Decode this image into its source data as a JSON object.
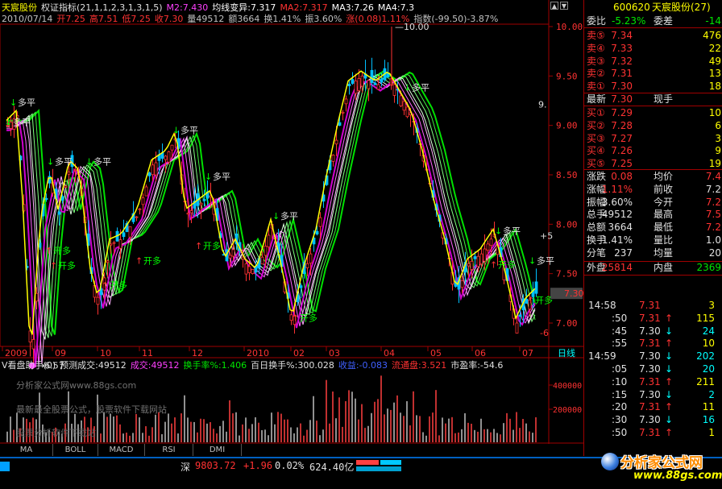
{
  "header": {
    "line1": [
      {
        "text": "天宸股份",
        "color": "#ffff00"
      },
      {
        "text": "权证指标(21,1,1,2,3,1,3,1,5)",
        "color": "#e0e0e0"
      },
      {
        "text": "M2:7.430",
        "color": "#ff40ff"
      },
      {
        "text": "均线变异:7.317",
        "color": "#ffffff"
      },
      {
        "text": "MA2:7.317",
        "color": "#ff3232"
      },
      {
        "text": "MA3:7.26",
        "color": "#ffffff"
      },
      {
        "text": "MA4:7.3",
        "color": "#ffffff"
      }
    ],
    "line2": [
      {
        "text": "2010/07/14",
        "color": "#c0c0c0"
      },
      {
        "text": "开7.25",
        "color": "#ff3232"
      },
      {
        "text": "高7.51",
        "color": "#ff3232"
      },
      {
        "text": "低7.25",
        "color": "#ff3232"
      },
      {
        "text": "收7.30",
        "color": "#ff3232"
      },
      {
        "text": "量49512",
        "color": "#c0c0c0"
      },
      {
        "text": "额3664",
        "color": "#c0c0c0"
      },
      {
        "text": "换1.41%",
        "color": "#c0c0c0"
      },
      {
        "text": "振3.60%",
        "color": "#c0c0c0"
      },
      {
        "text": "涨(0.08)1.11%",
        "color": "#ff3232"
      },
      {
        "text": "指数(-99.50)-3.87%",
        "color": "#c0c0c0"
      }
    ]
  },
  "price_axis": [
    "10.00",
    "9.50",
    "9.00",
    "8.50",
    "8.00",
    "7.50",
    "7.00"
  ],
  "price_marks": {
    "high": "10.00",
    "low": "6.57",
    "current": "7.30",
    "side_high": "9.",
    "side_low": "-6",
    "side_mid": "+5"
  },
  "signals": {
    "sell": "多平",
    "buy": "开多",
    "mixed": "开多平",
    "reverse": "多平"
  },
  "date_axis": [
    "2009",
    "09",
    "10",
    "11",
    "12",
    "2010",
    "02",
    "03",
    "04",
    "05",
    "06",
    "07"
  ],
  "period_label": "日线",
  "volume_header": [
    {
      "text": "V看盘助手(0)",
      "color": "#e0e0e0"
    },
    {
      "text": "预测成交:49512",
      "color": "#e0e0e0"
    },
    {
      "text": "成交:49512",
      "color": "#ff40ff"
    },
    {
      "text": "换手率%:1.406",
      "color": "#00e600"
    },
    {
      "text": "百日换手%:300.028",
      "color": "#e0e0e0"
    },
    {
      "text": "收益:-0.083",
      "color": "#4060ff"
    },
    {
      "text": "流通盘:3.521",
      "color": "#ff3232"
    },
    {
      "text": "市盈率:-54.6",
      "color": "#e0e0e0"
    }
  ],
  "volume_axis": [
    "400000",
    "200000"
  ],
  "watermarks": [
    "分析家公式网www.88gs.com",
    "最新最全股票公式，股票软件下载网站",
    "股票分析软件下载站"
  ],
  "tabs": [
    "MA",
    "BOLL",
    "MACD",
    "RSI",
    "DMI"
  ],
  "status_bar": {
    "index_name": "深",
    "index_value": "9803.72",
    "change": "+1.96",
    "pct": "0.02%",
    "amount": "624.40亿"
  },
  "logo": {
    "name": "分析家公式网",
    "url": "www.88gs.com"
  },
  "quote": {
    "code": "600620",
    "name": "天宸股份(27)",
    "weibi_label": "委比",
    "weibi": "-5.23%",
    "weicha_label": "委差",
    "weicha": "-14",
    "asks": [
      {
        "label": "卖⑤",
        "price": "7.34",
        "vol": "476"
      },
      {
        "label": "卖④",
        "price": "7.33",
        "vol": "22"
      },
      {
        "label": "卖③",
        "price": "7.32",
        "vol": "49"
      },
      {
        "label": "卖②",
        "price": "7.31",
        "vol": "13"
      },
      {
        "label": "卖①",
        "price": "7.30",
        "vol": "18"
      }
    ],
    "last_label": "最新",
    "last": "7.30",
    "hand_label": "现手",
    "bids": [
      {
        "label": "买①",
        "price": "7.29",
        "vol": "10"
      },
      {
        "label": "买②",
        "price": "7.28",
        "vol": "6"
      },
      {
        "label": "买③",
        "price": "7.27",
        "vol": "3"
      },
      {
        "label": "买④",
        "price": "7.26",
        "vol": "9"
      },
      {
        "label": "买⑤",
        "price": "7.25",
        "vol": "19"
      }
    ],
    "stats": [
      {
        "l1": "涨跌",
        "v1": "0.08",
        "c1": "red",
        "l2": "均价",
        "v2": "7.4",
        "c2": "red"
      },
      {
        "l1": "涨幅",
        "v1": "1.11%",
        "c1": "red",
        "l2": "前收",
        "v2": "7.2",
        "c2": "wht"
      },
      {
        "l1": "振幅",
        "v1": "3.60%",
        "c1": "wht",
        "l2": "今开",
        "v2": "7.2",
        "c2": "red"
      },
      {
        "l1": "总手",
        "v1": "49512",
        "c1": "wht",
        "l2": "最高",
        "v2": "7.5",
        "c2": "red"
      },
      {
        "l1": "总额",
        "v1": "3664",
        "c1": "wht",
        "l2": "最低",
        "v2": "7.2",
        "c2": "red"
      },
      {
        "l1": "换手",
        "v1": "1.41%",
        "c1": "wht",
        "l2": "量比",
        "v2": "1.0",
        "c2": "wht"
      },
      {
        "l1": "分笔",
        "v1": "237",
        "c1": "wht",
        "l2": "均量",
        "v2": "20",
        "c2": "wht"
      }
    ],
    "outer_label": "外盘",
    "outer": "25814",
    "inner_label": "内盘",
    "inner": "2369",
    "ticks": [
      {
        "time": "14:58",
        "price": "7.31",
        "vol": "3",
        "dir": ""
      },
      {
        "time": ":50",
        "price": "7.31",
        "vol": "115",
        "dir": "up"
      },
      {
        "time": ":45",
        "price": "7.30",
        "vol": "24",
        "dir": "down"
      },
      {
        "time": ":55",
        "price": "7.31",
        "vol": "10",
        "dir": "up"
      },
      {
        "time": "14:59",
        "price": "7.30",
        "vol": "202",
        "dir": "down"
      },
      {
        "time": ":05",
        "price": "7.30",
        "vol": "20",
        "dir": "down"
      },
      {
        "time": ":10",
        "price": "7.31",
        "vol": "211",
        "dir": "up"
      },
      {
        "time": ":15",
        "price": "7.30",
        "vol": "2",
        "dir": "down"
      },
      {
        "time": ":20",
        "price": "7.31",
        "vol": "11",
        "dir": "up"
      },
      {
        "time": ":30",
        "price": "7.30",
        "vol": "16",
        "dir": "down"
      },
      {
        "time": ":50",
        "price": "7.31",
        "vol": "1",
        "dir": "up"
      }
    ]
  }
}
